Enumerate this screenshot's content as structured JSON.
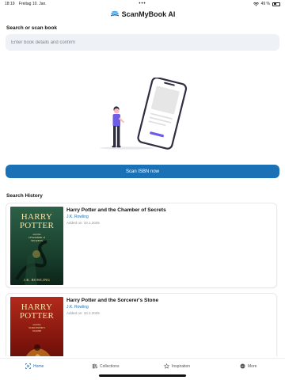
{
  "status_bar": {
    "time": "18:19",
    "date": "Freitag 10. Jan.",
    "wifi_icon": "wifi-icon",
    "battery_percent": "49 %",
    "battery_level": 0.49
  },
  "header": {
    "title": "ScanMyBook AI",
    "logo_icon": "book-stack-icon"
  },
  "search": {
    "section_label": "Search or scan book",
    "placeholder": "Enter book details and confirm",
    "value": ""
  },
  "illustration": {
    "name": "person-with-phone-illustration"
  },
  "scan_button": {
    "label": "Scan ISBN now"
  },
  "history": {
    "section_label": "Search History",
    "items": [
      {
        "title": "Harry Potter and the Chamber of Secrets",
        "author": "J.K. Rowling",
        "added": "Added on: 10.1.2025",
        "cover": {
          "line1": "HARRY",
          "line2": "POTTER",
          "sub1": "and the",
          "sub2": "CHAMBER of",
          "sub3": "SECRETS",
          "author": "J.K. ROWLING",
          "bg_top": "#23503a",
          "bg_bottom": "#0f2a1e",
          "text_color": "#f4e3a6"
        }
      },
      {
        "title": "Harry Potter and the Sorcerer's Stone",
        "author": "J.K. Rowling",
        "added": "Added on: 10.1.2025",
        "cover": {
          "line1": "HARRY",
          "line2": "POTTER",
          "sub1": "and the",
          "sub2": "SORCERER'S",
          "sub3": "STONE",
          "author": "",
          "bg_top": "#9e1e14",
          "bg_bottom": "#5a0c08",
          "text_color": "#f4e3a6"
        }
      }
    ]
  },
  "tabs": [
    {
      "label": "Home",
      "icon": "home-scan-icon",
      "active": true
    },
    {
      "label": "Collections",
      "icon": "library-icon",
      "active": false
    },
    {
      "label": "Inspiration",
      "icon": "star-icon",
      "active": false
    },
    {
      "label": "More",
      "icon": "more-circle-icon",
      "active": false
    }
  ],
  "colors": {
    "accent": "#1a71b6",
    "input_bg": "#eef1f5",
    "illustration_purple": "#6c5ce7",
    "illustration_dark": "#2f2e41"
  }
}
